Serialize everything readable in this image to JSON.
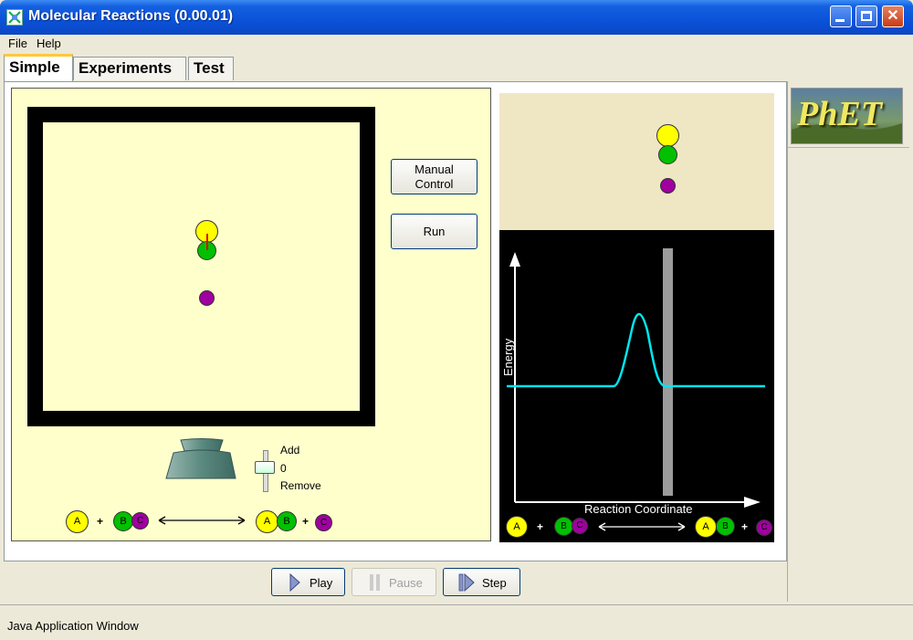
{
  "window": {
    "title": "Molecular Reactions (0.00.01)"
  },
  "menu": {
    "file": "File",
    "help": "Help"
  },
  "tabs": [
    "Simple",
    "Experiments",
    "Test"
  ],
  "buttons": {
    "manual_control": [
      "Manual",
      "Control"
    ],
    "run": "Run"
  },
  "slider": {
    "add": "Add",
    "zero": "0",
    "remove": "Remove"
  },
  "equation": {
    "a": "A",
    "b": "B",
    "c": "C",
    "plus": "+"
  },
  "energy_chart": {
    "ylabel": "Energy",
    "xlabel": "Reaction Coordinate",
    "line_color": "#00e6f0"
  },
  "logo": "PhET",
  "controls": {
    "play": "Play",
    "pause": "Pause",
    "step": "Step"
  },
  "status": "Java Application Window",
  "colors": {
    "a": "#ffff00",
    "b": "#00c800",
    "c": "#a000a0",
    "box_bg": "#ffffcc"
  }
}
